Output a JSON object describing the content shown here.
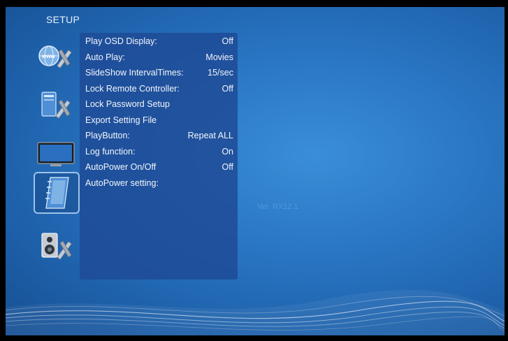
{
  "header": {
    "title": "SETUP"
  },
  "categories": [
    {
      "name": "network",
      "icon": "globe-tools-icon",
      "selected": false
    },
    {
      "name": "system",
      "icon": "computer-tools-icon",
      "selected": false
    },
    {
      "name": "video",
      "icon": "tv-display-icon",
      "selected": false
    },
    {
      "name": "misc",
      "icon": "notebook-icon",
      "selected": true
    },
    {
      "name": "audio",
      "icon": "speaker-tools-icon",
      "selected": false
    }
  ],
  "menu": {
    "items": [
      {
        "label": "Play OSD Display:",
        "value": "Off"
      },
      {
        "label": "Auto Play:",
        "value": "Movies"
      },
      {
        "label": "SlideShow IntervalTimes:",
        "value": "15/sec"
      },
      {
        "label": "Lock Remote Controller:",
        "value": "Off"
      },
      {
        "label": "Lock Password Setup",
        "value": ""
      },
      {
        "label": "Export Setting File",
        "value": ""
      },
      {
        "label": "PlayButton:",
        "value": "Repeat ALL"
      },
      {
        "label": "Log function:",
        "value": "On"
      },
      {
        "label": "AutoPower On/Off",
        "value": "Off"
      },
      {
        "label": "AutoPower setting:",
        "value": ""
      }
    ]
  },
  "footer": {
    "version": "Ver. RX12.1"
  },
  "colors": {
    "background": "#2b78c6",
    "panel": "#1e4b96",
    "text": "#f2f6fb"
  }
}
